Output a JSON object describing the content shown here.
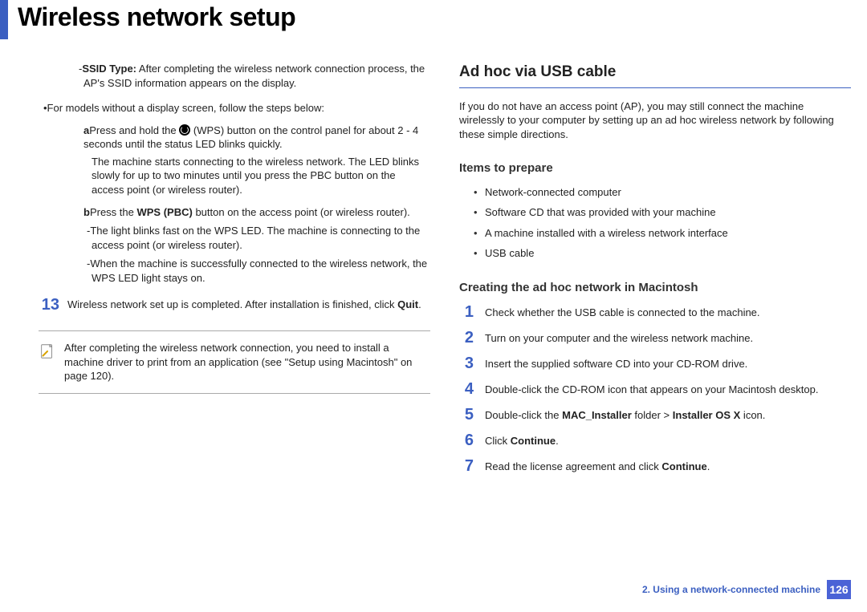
{
  "header": {
    "title": "Wireless network setup"
  },
  "left": {
    "ssid": {
      "label": "SSID Type:",
      "text": " After completing the wireless network connection process, the AP's SSID information appears on the display."
    },
    "no_display_note": "•For models without a display screen, follow the steps below:",
    "step_a": {
      "label": "a",
      "text_before": "Press and hold the ",
      "text_after": " (WPS) button on the control panel for about 2 - 4 seconds until the status LED blinks quickly.",
      "body": "The machine starts connecting to the wireless network. The LED blinks slowly for up to two minutes until you press the PBC button on the access point (or wireless router)."
    },
    "step_b": {
      "label": "b",
      "text_before": "Press the ",
      "bold": "WPS (PBC)",
      "text_after": " button on the access point (or wireless router).",
      "dash1": "-The light blinks fast on the WPS LED. The machine is connecting to the access point (or wireless router).",
      "dash2": "-When the machine is successfully connected to the wireless network, the WPS LED light stays on."
    },
    "step13": {
      "num": "13",
      "text_before": "Wireless network set up is completed. After installation is finished, click ",
      "bold": "Quit",
      "text_after": "."
    },
    "note": "After completing the wireless network connection, you need to install a machine driver to print from an application (see \"Setup using Macintosh\" on page 120)."
  },
  "right": {
    "h2": "Ad hoc via USB cable",
    "intro": "If you do not have an access point (AP), you may still connect the machine wirelessly to your computer by setting up an ad hoc wireless network by following these simple directions.",
    "prepare_h3": "Items to prepare",
    "prepare_items": [
      "Network-connected computer",
      "Software CD that was provided with your machine",
      "A machine installed with a wireless network interface",
      "USB cable"
    ],
    "create_h3": "Creating the ad hoc network in Macintosh",
    "steps": [
      {
        "n": "1",
        "text": "Check whether the USB cable is connected to the machine."
      },
      {
        "n": "2",
        "text": "Turn on your computer and the wireless network machine."
      },
      {
        "n": "3",
        "text": "Insert the supplied software CD into your CD-ROM drive."
      },
      {
        "n": "4",
        "text": "Double-click the CD-ROM icon that appears on your Macintosh desktop."
      },
      {
        "n": "5",
        "before": "Double-click the ",
        "b1": "MAC_Installer",
        "mid": " folder > ",
        "b2": "Installer OS X",
        "after": " icon."
      },
      {
        "n": "6",
        "before": "Click ",
        "b1": "Continue",
        "after": "."
      },
      {
        "n": "7",
        "before": "Read the license agreement and click ",
        "b1": "Continue",
        "after": "."
      }
    ]
  },
  "footer": {
    "chapter": "2.  Using a network-connected machine",
    "page": "126"
  }
}
